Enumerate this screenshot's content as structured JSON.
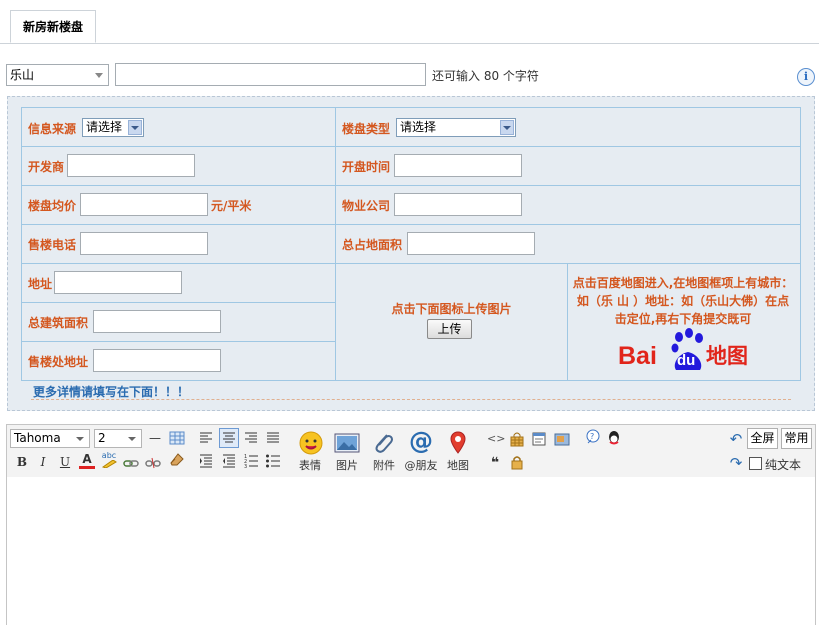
{
  "tab": {
    "label": "新房新楼盘"
  },
  "subject": {
    "city": "乐山",
    "title_value": "",
    "counter_text": "还可输入 80 个字符",
    "info_icon": "i"
  },
  "form": {
    "source_label": "信息来源",
    "source_value": "请选择",
    "type_label": "楼盘类型",
    "type_value": "请选择",
    "developer_label": "开发商",
    "open_time_label": "开盘时间",
    "avg_price_label": "楼盘均价",
    "price_unit": "元/平米",
    "property_label": "物业公司",
    "phone_label": "售楼电话",
    "land_area_label": "总占地面积",
    "address_label": "地址",
    "build_area_label": "总建筑面积",
    "sales_address_label": "售楼处地址",
    "upload_hint": "点击下面图标上传图片",
    "upload_button": "上传",
    "map_hint": "点击百度地图进入,在地图框项上有城市：如（乐 山 ）地址：如（乐山大佛）在点击定位,再右下角提交既可",
    "map_logo_bai": "Bai",
    "map_logo_du": "du",
    "map_logo_cn": "地图",
    "more_text": "更多详情请填写在下面！！！"
  },
  "toolbar": {
    "font": "Tahoma",
    "size": "2",
    "bold": "B",
    "italic": "I",
    "underline": "U",
    "font_color": "A",
    "highlight": "abc",
    "emoji_label": "表情",
    "image_label": "图片",
    "attach_label": "附件",
    "at_label": "@朋友",
    "map_label": "地图",
    "at_symbol": "@",
    "code_symbol": "<>",
    "quote_symbol": "❝",
    "fullscreen": "全屏",
    "common": "常用",
    "plaintext_label": "纯文本"
  },
  "colors": {
    "label_red": "#d4571f",
    "link_blue": "#2b6cb0",
    "panel_bg": "#e6ecf2",
    "grid_line": "#9fc7e3"
  }
}
